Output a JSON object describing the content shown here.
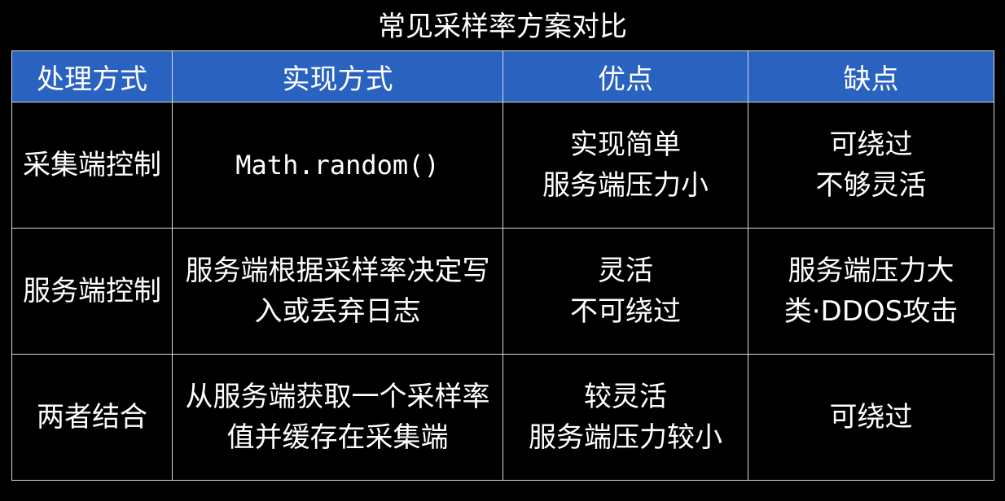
{
  "title": "常见采样率方案对比",
  "table": {
    "headers": [
      "处理方式",
      "实现方式",
      "优点",
      "缺点"
    ],
    "rows": [
      {
        "method": "采集端控制",
        "implementation": [
          "Math.random()"
        ],
        "pros": [
          "实现简单",
          "服务端压力小"
        ],
        "cons": [
          "可绕过",
          "不够灵活"
        ]
      },
      {
        "method": "服务端控制",
        "implementation": [
          "服务端根据采样率决定写",
          "入或丢弃日志"
        ],
        "pros": [
          "灵活",
          "不可绕过"
        ],
        "cons": [
          "服务端压力大",
          "类·DDOS攻击"
        ]
      },
      {
        "method": "两者结合",
        "implementation": [
          "从服务端获取一个采样率",
          "值并缓存在采集端"
        ],
        "pros": [
          "较灵活",
          "服务端压力较小"
        ],
        "cons": [
          "可绕过"
        ]
      }
    ]
  },
  "colors": {
    "background": "#000000",
    "header_bg": "#2a62c0",
    "grid": "#d9d9d9",
    "text": "#ffffff"
  }
}
